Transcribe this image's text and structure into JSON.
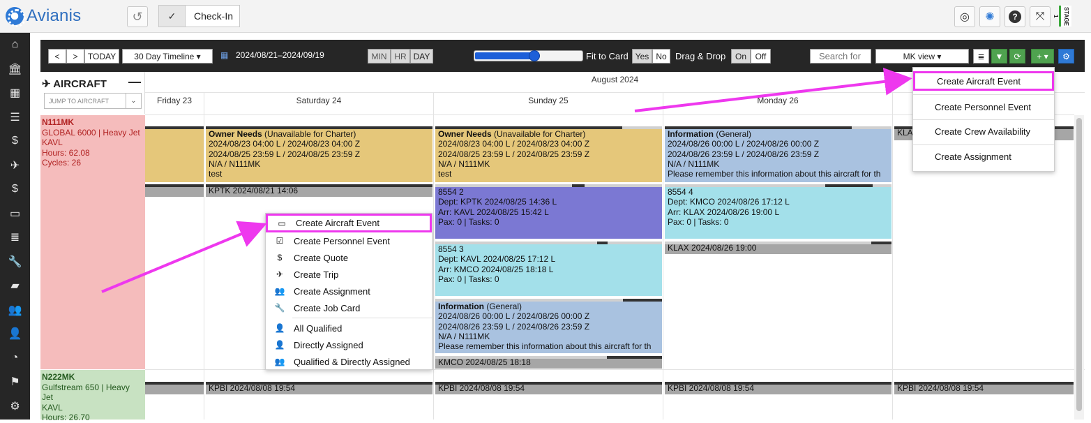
{
  "app": {
    "name": "Avianis",
    "checkin_label": "Check-In",
    "stage_label": "STAGE 1"
  },
  "toolbar": {
    "prev": "<",
    "next": ">",
    "today": "TODAY",
    "timeline": "30 Day Timeline ▾",
    "date_range": "2024/08/21–2024/09/19",
    "zoom": {
      "min": "MIN",
      "hr": "HR",
      "day": "DAY",
      "selected": "DAY"
    },
    "zoom_slider_percent": 56,
    "fit_label": "Fit to Card",
    "yes": "Yes",
    "no": "No",
    "fit_selected": "Yes",
    "dragdrop_label": "Drag & Drop",
    "on": "On",
    "off": "Off",
    "dragdrop_selected": "On",
    "search_placeholder": "Search for",
    "view": "MK view ▾",
    "add": "+ ▾"
  },
  "aircraft_panel": {
    "title": "AIRCRAFT",
    "collapse": "—",
    "jump_placeholder": "JUMP TO AIRCRAFT"
  },
  "calendar": {
    "month": "August 2024",
    "days": [
      "Friday 23",
      "Saturday 24",
      "Sunday 25",
      "Monday 26"
    ]
  },
  "aircraft": [
    {
      "tail": "N111MK",
      "type": "GLOBAL 6000 | Heavy Jet",
      "base": "KAVL",
      "hours": "Hours: 62.08",
      "cycles": "Cycles: 26"
    },
    {
      "tail": "N222MK",
      "type": "Gulfstream 650 | Heavy",
      "type2": "Jet",
      "base": "KAVL",
      "hours": "Hours: 26.70"
    }
  ],
  "events": {
    "owner_sat": {
      "title": "Owner Needs",
      "sub": " (Unavailable for Charter)",
      "l1": "2024/08/23 04:00 L / 2024/08/23 04:00 Z",
      "l2": "2024/08/25 23:59 L / 2024/08/25 23:59 Z",
      "l3": "N/A / N111MK",
      "l4": "test"
    },
    "owner_sun": {
      "title": "Owner Needs",
      "sub": " (Unavailable for Charter)",
      "l1": "2024/08/23 04:00 L / 2024/08/23 04:00 Z",
      "l2": "2024/08/25 23:59 L / 2024/08/25 23:59 Z",
      "l3": "N/A / N111MK",
      "l4": "test"
    },
    "info_mon": {
      "title": "Information",
      "sub": " (General)",
      "l1": "2024/08/26 00:00 L / 2024/08/26 00:00 Z",
      "l2": "2024/08/26 23:59 L / 2024/08/26 23:59 Z",
      "l3": "N/A / N111MK",
      "l4": "Please remember this information about this aircraft for th"
    },
    "info_sun": {
      "title": "Information",
      "sub": " (General)",
      "l1": "2024/08/26 00:00 L / 2024/08/26 00:00 Z",
      "l2": "2024/08/26 23:59 L / 2024/08/26 23:59 Z",
      "l3": "N/A / N111MK",
      "l4": "Please remember this information about this aircraft for th"
    },
    "trip_8554_2": {
      "l0": "8554 2",
      "l1": "Dept: KPTK 2024/08/25 14:36 L",
      "l2": "Arr: KAVL 2024/08/25 15:42 L",
      "l3": "Pax: 0 | Tasks: 0"
    },
    "trip_8554_3": {
      "l0": "8554 3",
      "l1": "Dept: KAVL 2024/08/25 17:12 L",
      "l2": "Arr: KMCO 2024/08/25 18:18 L",
      "l3": "Pax: 0 | Tasks: 0"
    },
    "trip_8554_4": {
      "l0": "8554 4",
      "l1": "Dept: KMCO 2024/08/26 17:12 L",
      "l2": "Arr: KLAX 2024/08/26 19:00 L",
      "l3": "Pax: 0 | Tasks: 0"
    },
    "pos_kptk": "KPTK 2024/08/21 14:06",
    "pos_kmco": "KMCO 2024/08/25 18:18",
    "pos_klax": "KLAX 2024/08/26 19:00",
    "pos_kla_trunc": "KLA",
    "pos_kpbi": "KPBI 2024/08/08 19:54"
  },
  "context_menu": [
    {
      "label": "Create Aircraft Event",
      "icon": "aircraft-event-icon",
      "glyph": "▭"
    },
    {
      "label": "Create Personnel Event",
      "icon": "checkbox-icon",
      "glyph": "☑"
    },
    {
      "label": "Create Quote",
      "icon": "quote-file-icon",
      "glyph": "$"
    },
    {
      "label": "Create Trip",
      "icon": "plane-icon",
      "glyph": "✈"
    },
    {
      "label": "Create Assignment",
      "icon": "users-icon",
      "glyph": "👥"
    },
    {
      "label": "Create Job Card",
      "icon": "wrench-icon",
      "glyph": "🔧"
    },
    {
      "label": "All Qualified",
      "icon": "user-icon",
      "glyph": "👤"
    },
    {
      "label": "Directly Assigned",
      "icon": "user-icon",
      "glyph": "👤"
    },
    {
      "label": "Qualified & Directly Assigned",
      "icon": "users-group-icon",
      "glyph": "👥"
    }
  ],
  "add_menu": [
    "Create Aircraft Event",
    "Create Personnel Event",
    "Create Crew Availability",
    "Create Assignment"
  ],
  "colors": {
    "highlight": "#ee38ee",
    "owner": "#e5c77a",
    "info": "#a9c2e0",
    "trip_purple": "#7b78d3",
    "trip_cyan": "#a3e0ea",
    "positioning": "#a6a6a6"
  }
}
